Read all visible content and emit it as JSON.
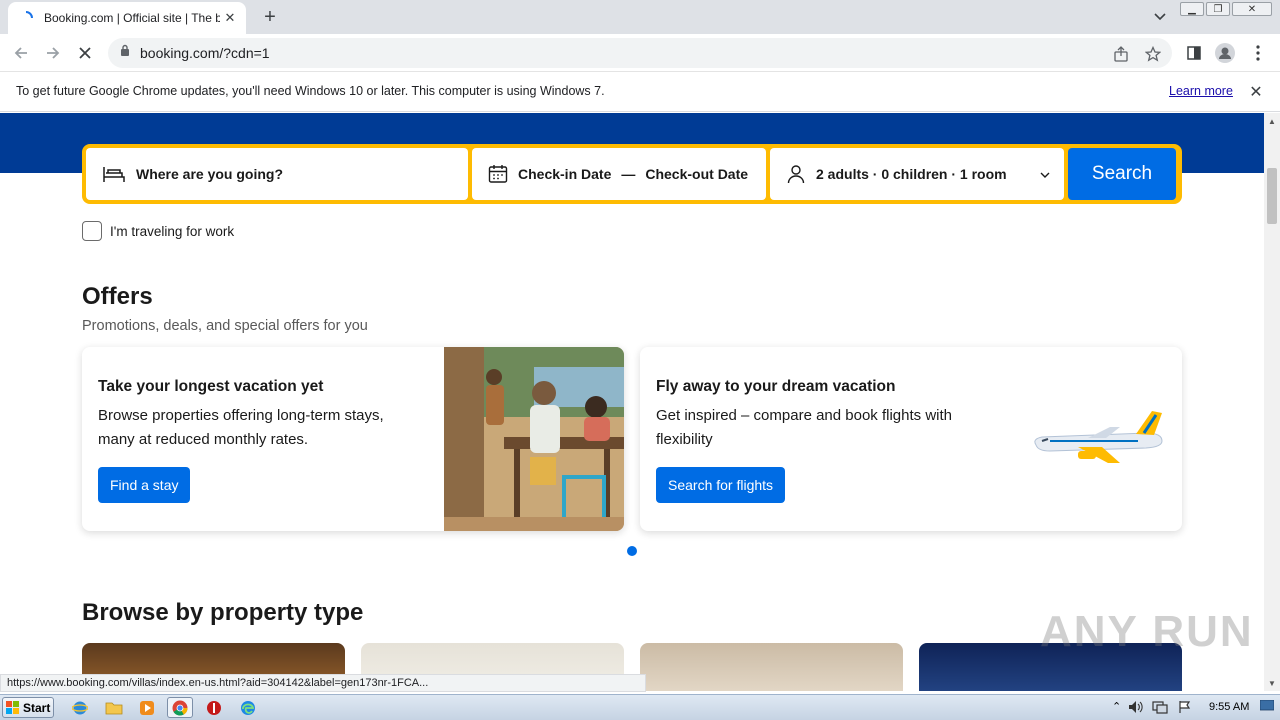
{
  "browser": {
    "tab_title": "Booking.com | Official site | The best",
    "url": "booking.com/?cdn=1"
  },
  "infobar": {
    "message": "To get future Google Chrome updates, you'll need Windows 10 or later. This computer is using Windows 7.",
    "learn_more": "Learn more"
  },
  "search": {
    "destination_placeholder": "Where are you going?",
    "checkin": "Check-in Date",
    "dash": "—",
    "checkout": "Check-out Date",
    "guests": "2 adults · 0 children · 1 room",
    "button": "Search",
    "work_label": "I'm traveling for work"
  },
  "offers": {
    "heading": "Offers",
    "subheading": "Promotions, deals, and special offers for you",
    "cards": [
      {
        "title": "Take your longest vacation yet",
        "text": "Browse properties offering long-term stays, many at reduced monthly rates.",
        "button": "Find a stay"
      },
      {
        "title": "Fly away to your dream vacation",
        "text": "Get inspired – compare and book flights with flexibility",
        "button": "Search for flights"
      }
    ]
  },
  "browse": {
    "heading": "Browse by property type"
  },
  "status_url": "https://www.booking.com/villas/index.en-us.html?aid=304142&label=gen173nr-1FCA...",
  "watermark": "ANY RUN",
  "taskbar": {
    "start": "Start",
    "time": "9:55 AM"
  },
  "colors": {
    "brand_blue": "#003b95",
    "action_blue": "#006ce4",
    "search_border": "#febb02"
  }
}
